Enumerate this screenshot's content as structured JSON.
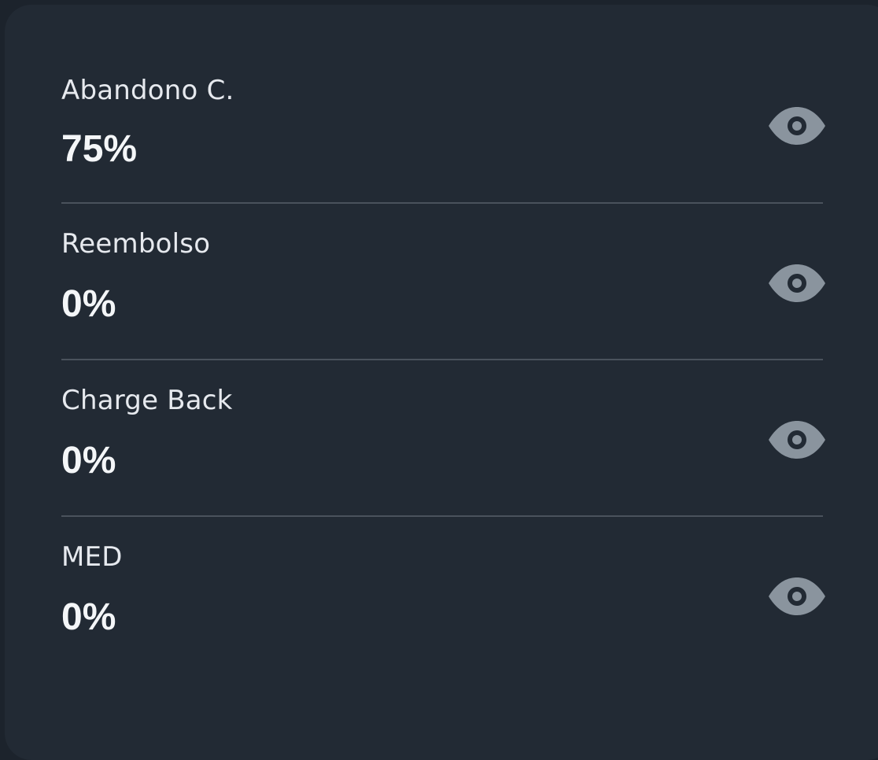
{
  "colors": {
    "background": "#1c232c",
    "card": "#222a34",
    "divider": "#4a525c",
    "label": "#e6e9ee",
    "value": "#f4f6f8",
    "icon": "#8a949e"
  },
  "metrics": [
    {
      "label": "Abandono C.",
      "value": "75%",
      "icon": "eye-icon"
    },
    {
      "label": "Reembolso",
      "value": "0%",
      "icon": "eye-icon"
    },
    {
      "label": "Charge Back",
      "value": "0%",
      "icon": "eye-icon"
    },
    {
      "label": "MED",
      "value": "0%",
      "icon": "eye-icon"
    }
  ]
}
